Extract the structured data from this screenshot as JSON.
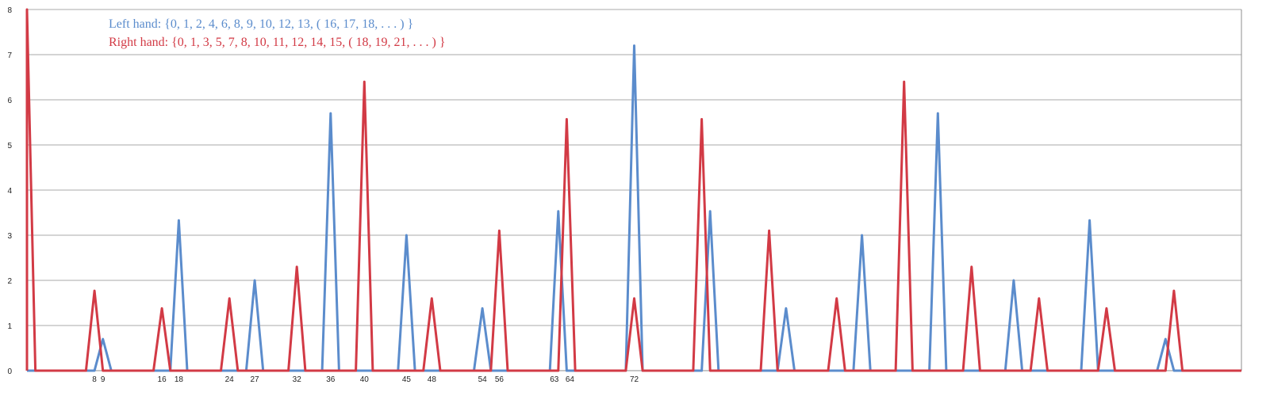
{
  "chart_data": {
    "type": "line",
    "title": "",
    "xlabel": "",
    "ylabel": "",
    "xlim": [
      0,
      144
    ],
    "ylim": [
      0,
      8
    ],
    "y_ticks": [
      "0",
      "1",
      "2",
      "3",
      "4",
      "5",
      "6",
      "7",
      "8"
    ],
    "x_tick_labels": [
      {
        "x": 8,
        "label": "8"
      },
      {
        "x": 9,
        "label": "9"
      },
      {
        "x": 16,
        "label": "16"
      },
      {
        "x": 18,
        "label": "18"
      },
      {
        "x": 24,
        "label": "24"
      },
      {
        "x": 27,
        "label": "27"
      },
      {
        "x": 32,
        "label": "32"
      },
      {
        "x": 36,
        "label": "36"
      },
      {
        "x": 40,
        "label": "40"
      },
      {
        "x": 45,
        "label": "45"
      },
      {
        "x": 48,
        "label": "48"
      },
      {
        "x": 54,
        "label": "54"
      },
      {
        "x": 56,
        "label": "56"
      },
      {
        "x": 63,
        "label": "63"
      },
      {
        "x": 64,
        "label": "64"
      },
      {
        "x": 72,
        "label": "72"
      }
    ],
    "grid": true,
    "legend": [
      {
        "text": "Left hand: {0, 1, 2, 4, 6, 8, 9, 10, 12, 13, ( 16, 17, 18, . . . ) }",
        "color": "#5b8ccc"
      },
      {
        "text": "Right hand: {0, 1, 3, 5, 7, 8, 10, 11, 12, 14, 15, ( 18, 19, 21, . . . ) }",
        "color": "#d23a45"
      }
    ],
    "series": [
      {
        "color": "#5b8ccc",
        "points": [
          {
            "x": 9,
            "y": 0.7
          },
          {
            "x": 18,
            "y": 3.33
          },
          {
            "x": 27,
            "y": 2.0
          },
          {
            "x": 36,
            "y": 5.7
          },
          {
            "x": 45,
            "y": 3.0
          },
          {
            "x": 54,
            "y": 1.38
          },
          {
            "x": 63,
            "y": 3.53
          },
          {
            "x": 72,
            "y": 7.2
          },
          {
            "x": 81,
            "y": 3.53
          },
          {
            "x": 90,
            "y": 1.38
          },
          {
            "x": 99,
            "y": 3.0
          },
          {
            "x": 108,
            "y": 5.7
          },
          {
            "x": 117,
            "y": 2.0
          },
          {
            "x": 126,
            "y": 3.33
          },
          {
            "x": 135,
            "y": 0.7
          }
        ]
      },
      {
        "color": "#d23a45",
        "points": [
          {
            "x": 0,
            "y": 8.0
          },
          {
            "x": 8,
            "y": 1.77
          },
          {
            "x": 16,
            "y": 1.38
          },
          {
            "x": 24,
            "y": 1.6
          },
          {
            "x": 32,
            "y": 2.3
          },
          {
            "x": 40,
            "y": 6.4
          },
          {
            "x": 48,
            "y": 1.6
          },
          {
            "x": 56,
            "y": 3.1
          },
          {
            "x": 64,
            "y": 5.57
          },
          {
            "x": 72,
            "y": 1.6
          },
          {
            "x": 80,
            "y": 5.57
          },
          {
            "x": 88,
            "y": 3.1
          },
          {
            "x": 96,
            "y": 1.6
          },
          {
            "x": 104,
            "y": 6.4
          },
          {
            "x": 112,
            "y": 2.3
          },
          {
            "x": 120,
            "y": 1.6
          },
          {
            "x": 128,
            "y": 1.38
          },
          {
            "x": 136,
            "y": 1.77
          }
        ]
      }
    ]
  }
}
